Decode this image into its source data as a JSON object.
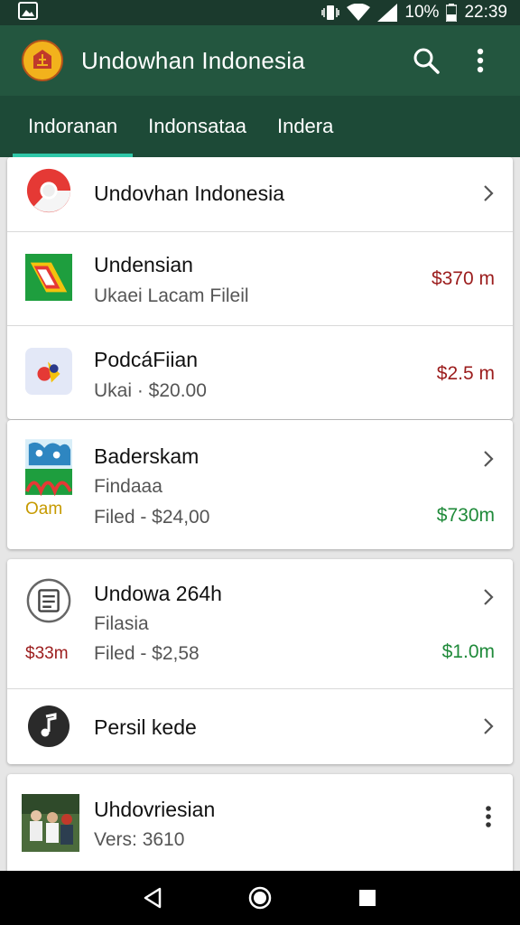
{
  "status_bar": {
    "battery": "10%",
    "time": "22:39"
  },
  "app_bar": {
    "title": "Undowhan Indonesia"
  },
  "tabs": [
    {
      "label": "Indoranan"
    },
    {
      "label": "Indonsataa"
    },
    {
      "label": "Indera"
    }
  ],
  "list": {
    "item1": {
      "title": "Undovhan Indonesia"
    },
    "item2": {
      "title": "Undensian",
      "subtitle": "Ukaei Lacam Fileil",
      "price": "$370 m"
    },
    "item3": {
      "title": "PodcáFiian",
      "subtitle": "Ukai · $20.00",
      "price": "$2.5 m"
    },
    "item4": {
      "title": "Baderskam",
      "subtitle": "Findaaa",
      "filed": "Filed - $24,00",
      "badge": "Oam",
      "price": "$730m"
    },
    "item5": {
      "title": "Undowa 264h",
      "subtitle": "Filasia",
      "filed": "Filed - $2,58",
      "badge": "$33m",
      "price": "$1.0m"
    },
    "item6": {
      "title": "Persil kede"
    },
    "item7": {
      "title": "Uhdovriesian",
      "subtitle": "Vers: 3610"
    }
  },
  "colors": {
    "status_bar": "#1b3a2d",
    "app_bar": "#23563f",
    "tab_bar": "#1d4a37",
    "tab_indicator": "#2fc7a8",
    "price_red": "#9b1c1c",
    "price_green": "#1f8a3a",
    "badge_gold": "#c69a00"
  },
  "icons": {
    "app_logo": "emblem-icon",
    "search": "search-icon",
    "more": "more-vert-icon"
  }
}
